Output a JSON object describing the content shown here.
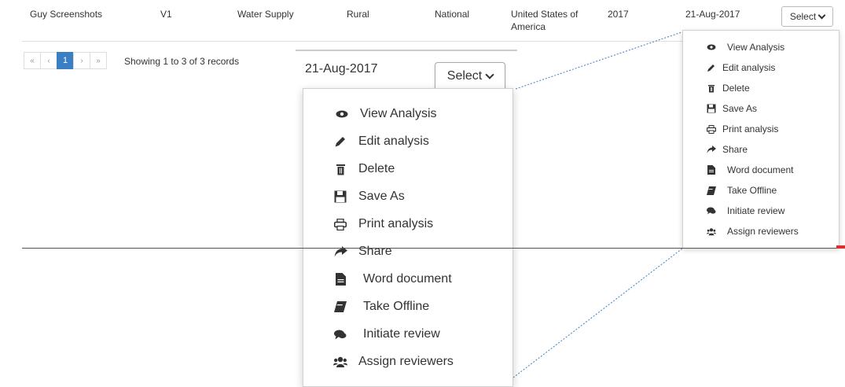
{
  "table_row": {
    "name": "Guy Screenshots",
    "version": "V1",
    "sector": "Water Supply",
    "area": "Rural",
    "level": "National",
    "country_line1": "United States of",
    "country_line2": "America",
    "year": "2017",
    "date": "21-Aug-2017",
    "select_label": "Select"
  },
  "pagination": {
    "first": "«",
    "prev": "‹",
    "current": "1",
    "next": "›",
    "last": "»",
    "summary": "Showing 1 to 3 of 3 records"
  },
  "zoom": {
    "date": "21-Aug-2017",
    "select_label": "Select"
  },
  "menu_items": [
    {
      "label": "View Analysis",
      "icon": "eye-icon"
    },
    {
      "label": "Edit analysis",
      "icon": "pencil-icon"
    },
    {
      "label": "Delete",
      "icon": "trash-icon"
    },
    {
      "label": "Save As",
      "icon": "floppy-icon"
    },
    {
      "label": "Print analysis",
      "icon": "print-icon"
    },
    {
      "label": "Share",
      "icon": "share-icon"
    },
    {
      "label": "Word document",
      "icon": "document-icon"
    },
    {
      "label": "Take Offline",
      "icon": "book-icon"
    },
    {
      "label": "Initiate review",
      "icon": "comments-icon"
    },
    {
      "label": "Assign reviewers",
      "icon": "users-icon"
    }
  ],
  "colors": {
    "active_page": "#3a7fc4",
    "connector": "#3a7fc4",
    "marker": "#d9302c"
  }
}
